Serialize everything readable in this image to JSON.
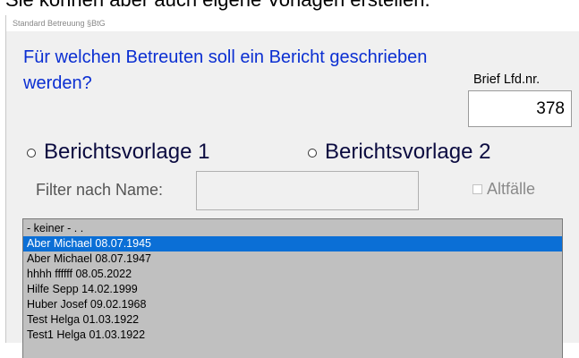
{
  "top_text": "Sie können aber auch eigene Vorlagen erstellen.",
  "window_title": "Standard  Betreuung §BtG",
  "question": "Für welchen Betreuten soll ein Bericht geschrieben werden?",
  "brief": {
    "label": "Brief Lfd.nr.",
    "value": "378"
  },
  "radio_options": [
    "Berichtsvorlage 1",
    "Berichtsvorlage 2"
  ],
  "filter": {
    "label": "Filter nach Name:",
    "value": ""
  },
  "altfaelle": {
    "label": "Altfälle",
    "checked": false
  },
  "list": {
    "items": [
      "- keiner -    . .",
      "Aber Michael 08.07.1945",
      "Aber Michael 08.07.1947",
      "hhhh ffffff 08.05.2022",
      "Hilfe Sepp 14.02.1999",
      "Huber Josef 09.02.1968",
      "Test Helga 01.03.1922",
      "Test1 Helga 01.03.1922"
    ],
    "selected_index": 1
  },
  "colors": {
    "question": "#0b2fd2",
    "selection": "#0b6fd6",
    "list_bg": "#c0c0c0"
  }
}
